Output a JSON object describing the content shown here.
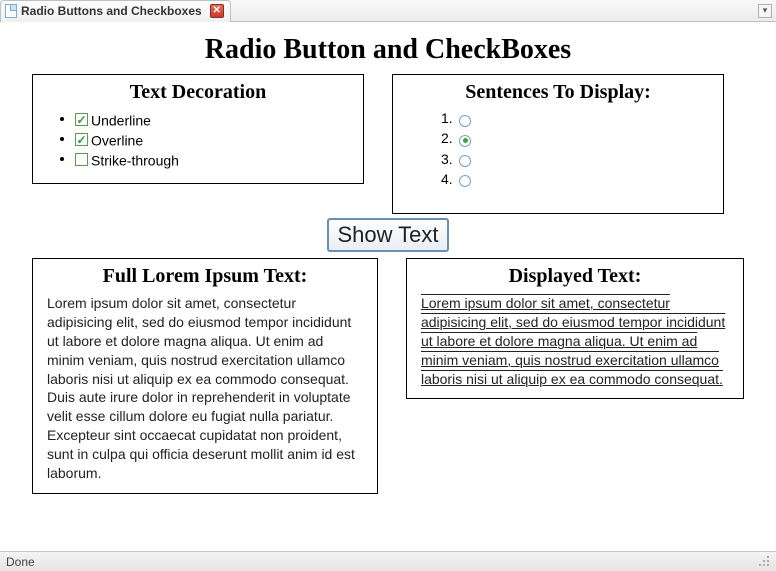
{
  "tab": {
    "title": "Radio Buttons and Checkboxes"
  },
  "page_title": "Radio Button and CheckBoxes",
  "panels": {
    "decoration_title": "Text Decoration",
    "sentences_title": "Sentences To Display:",
    "full_title": "Full Lorem Ipsum Text:",
    "displayed_title": "Displayed Text:"
  },
  "checkboxes": [
    {
      "label": "Underline",
      "checked": true
    },
    {
      "label": "Overline",
      "checked": true
    },
    {
      "label": "Strike-through",
      "checked": false
    }
  ],
  "radios": [
    {
      "num": "1.",
      "checked": false
    },
    {
      "num": "2.",
      "checked": true
    },
    {
      "num": "3.",
      "checked": false
    },
    {
      "num": "4.",
      "checked": false
    }
  ],
  "show_button": "Show Text",
  "full_text": "Lorem ipsum dolor sit amet, consectetur adipisicing elit, sed do eiusmod tempor incididunt ut labore et dolore magna aliqua. Ut enim ad minim veniam, quis nostrud exercitation ullamco laboris nisi ut aliquip ex ea commodo consequat. Duis aute irure dolor in reprehenderit in voluptate velit esse cillum dolore eu fugiat nulla pariatur. Excepteur sint occaecat cupidatat non proident, sunt in culpa qui officia deserunt mollit anim id est laborum.",
  "displayed_text": "Lorem ipsum dolor sit amet, consectetur adipisicing elit, sed do eiusmod tempor incididunt ut labore et dolore magna aliqua. Ut enim ad minim veniam, quis nostrud exercitation ullamco laboris nisi ut aliquip ex ea commodo consequat.",
  "status": "Done"
}
